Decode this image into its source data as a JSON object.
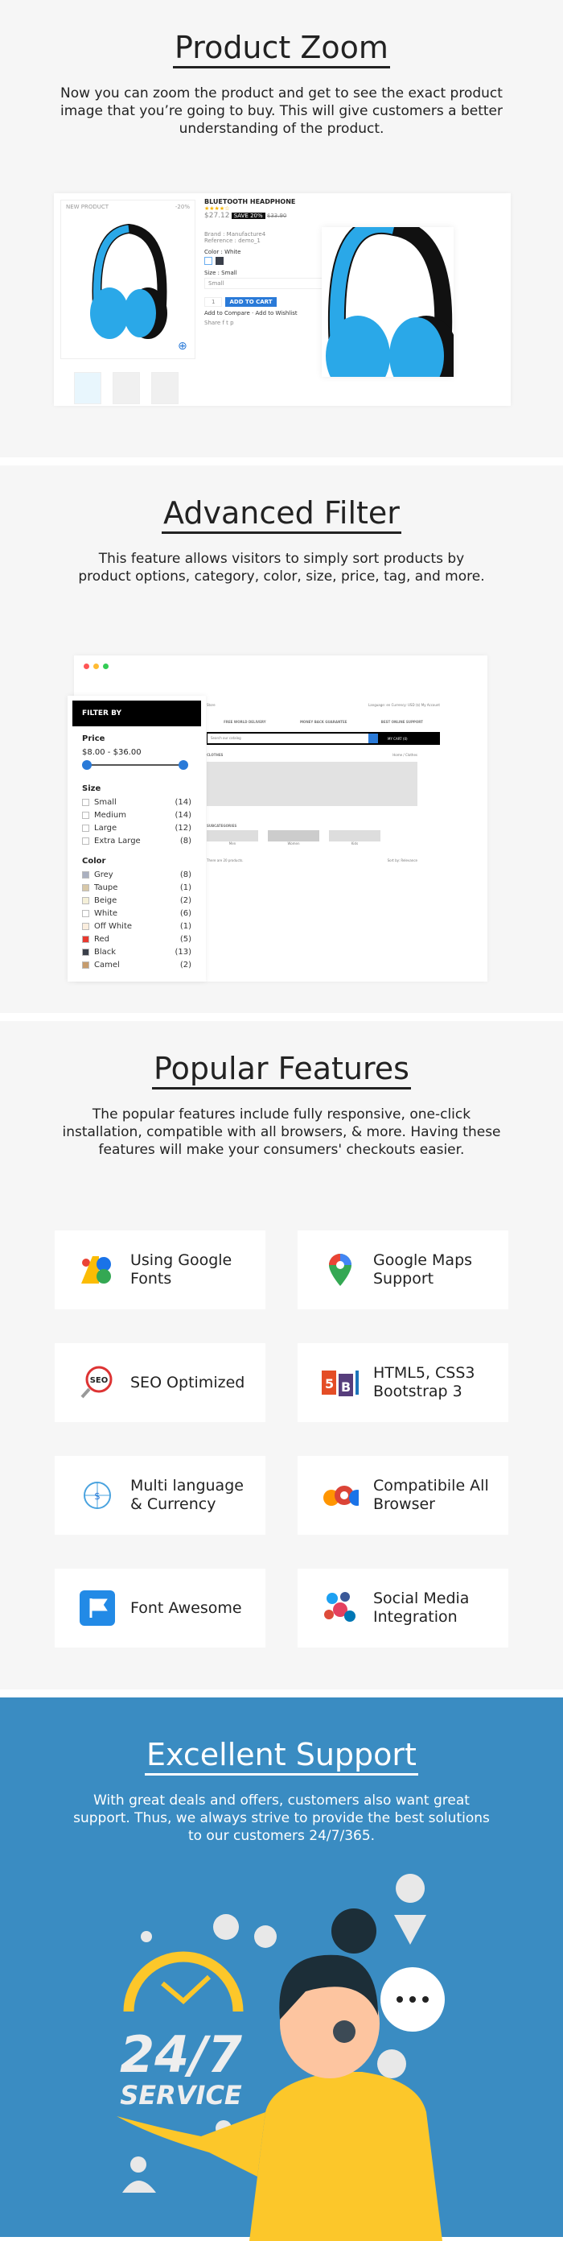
{
  "product_zoom": {
    "title": "Product Zoom",
    "description": "Now you can zoom the product and get to see the exact product image that you’re going to buy. This will give customers a better understanding of the product.",
    "badge_new": "NEW PRODUCT",
    "badge_discount": "-20%",
    "product_name": "BLUETOOTH HEADPHONE",
    "rating": 4,
    "price": "$27.12",
    "save_label": "SAVE 20%",
    "old_price": "$33.90",
    "brand_label": "Brand",
    "brand_value": ": Manufacture4",
    "reference_label": "Reference",
    "reference_value": ": demo_1",
    "color_label": "Color : White",
    "size_label": "Size : Small",
    "size_value": "Small",
    "quantity": "1",
    "add_to_cart": "ADD TO CART",
    "compare": "Add to Compare",
    "wishlist": "Add to Wishlist",
    "share": "Share"
  },
  "advanced_filter": {
    "title": "Advanced Filter",
    "description": "This feature allows visitors to simply sort products by product options, category, color, size, price, tag, and more.",
    "filter_title": "FILTER BY",
    "price_label": "Price",
    "price_range": "$8.00 - $36.00",
    "size_label": "Size",
    "sizes": [
      {
        "label": "Small",
        "count": "(14)"
      },
      {
        "label": "Medium",
        "count": "(14)"
      },
      {
        "label": "Large",
        "count": "(12)"
      },
      {
        "label": "Extra Large",
        "count": "(8)"
      }
    ],
    "color_label": "Color",
    "colors": [
      {
        "label": "Grey",
        "count": "(8)",
        "hex": "#aab0c0"
      },
      {
        "label": "Taupe",
        "count": "(1)",
        "hex": "#d8c8a8"
      },
      {
        "label": "Beige",
        "count": "(2)",
        "hex": "#f5f0d8"
      },
      {
        "label": "White",
        "count": "(6)",
        "hex": "#ffffff"
      },
      {
        "label": "Off White",
        "count": "(1)",
        "hex": "#fbeede"
      },
      {
        "label": "Red",
        "count": "(5)",
        "hex": "#e8392f"
      },
      {
        "label": "Black",
        "count": "(13)",
        "hex": "#3a3f4a"
      },
      {
        "label": "Camel",
        "count": "(2)",
        "hex": "#c69c6d"
      }
    ],
    "store": {
      "nav_left": "Store",
      "language": "Language: en",
      "currency": "Currency: USD ($)",
      "account": "My Account",
      "benefits": [
        "FREE WORLD DELIVERY",
        "MONEY BACK GUARANTEE",
        "BEST ONLINE SUPPORT"
      ],
      "search_placeholder": "Search our catalog",
      "cart": "MY CART (0)",
      "category": "CLOTHES",
      "breadcrumb": "Home / Clothes",
      "subcategories_label": "SUBCATEGORIES",
      "subcategories": [
        "Men",
        "Women",
        "Kids"
      ],
      "product_count": "There are 20 products.",
      "sort_label": "Sort by:",
      "sort_value": "Relevance"
    }
  },
  "popular_features": {
    "title": "Popular Features",
    "description": "The popular features include  fully responsive, one-click installation, compatible with all browsers, & more. Having these features will make your consumers' checkouts easier.",
    "items": [
      {
        "label": "Using Google Fonts",
        "icon": "google-fonts-icon"
      },
      {
        "label": "Google Maps Support",
        "icon": "google-maps-icon"
      },
      {
        "label": "SEO Optimized",
        "icon": "seo-icon"
      },
      {
        "label": "HTML5, CSS3 Bootstrap 3",
        "icon": "html5-css3-bootstrap-icon"
      },
      {
        "label": "Multi language & Currency",
        "icon": "language-currency-icon"
      },
      {
        "label": "Compatibile All Browser",
        "icon": "browsers-icon"
      },
      {
        "label": "Font Awesome",
        "icon": "font-awesome-flag-icon"
      },
      {
        "label": "Social Media Integration",
        "icon": "social-media-icon"
      }
    ]
  },
  "support": {
    "title": "Excellent Support",
    "description": "With great deals and offers, customers also want great support. Thus, we always strive to provide the best solutions to our customers 24/7/365.",
    "badge_big": "24/7",
    "badge_small": "SERVICE",
    "bg": "#3a8cc2",
    "shirt": "#fcc72a"
  }
}
